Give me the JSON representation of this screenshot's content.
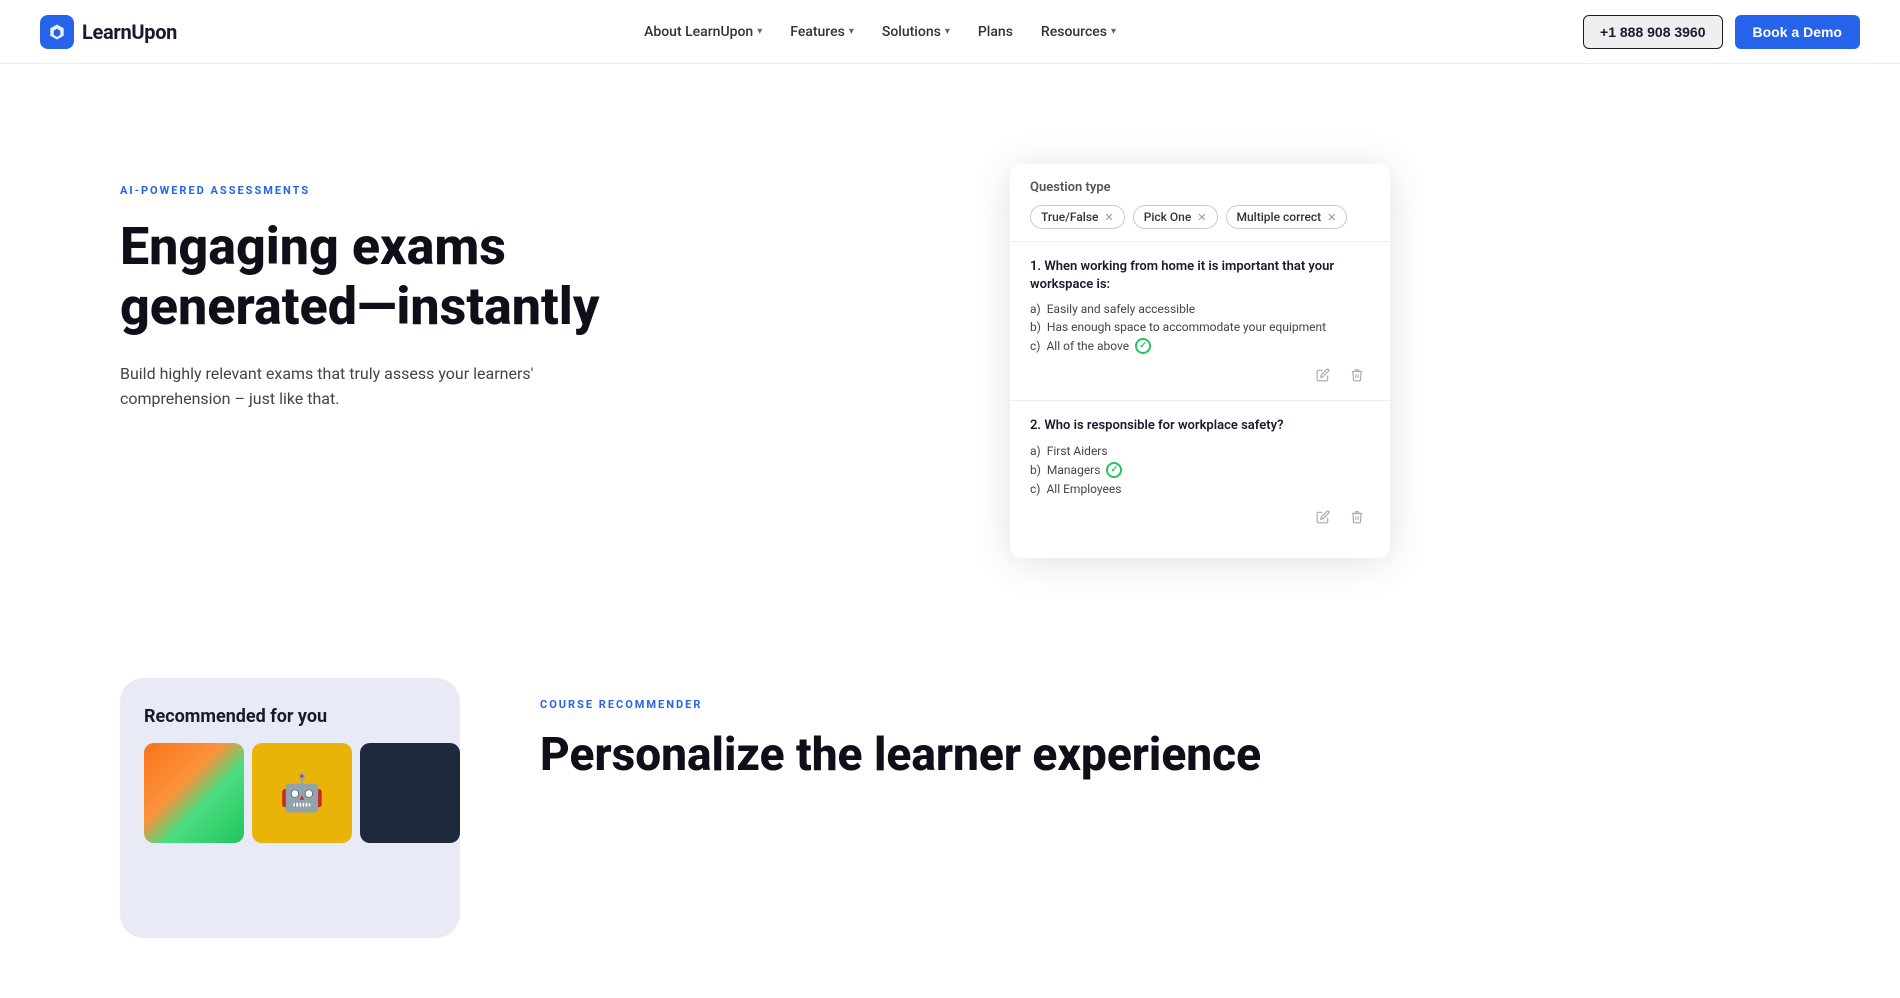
{
  "nav": {
    "logo_text": "LearnUpon",
    "links": [
      {
        "label": "About LearnUpon",
        "has_dropdown": true
      },
      {
        "label": "Features",
        "has_dropdown": true
      },
      {
        "label": "Solutions",
        "has_dropdown": true
      },
      {
        "label": "Plans",
        "has_dropdown": false
      },
      {
        "label": "Resources",
        "has_dropdown": true
      }
    ],
    "phone": "+1 888 908 3960",
    "demo_label": "Book a Demo"
  },
  "hero": {
    "badge": "AI-POWERED ASSESSMENTS",
    "title": "Engaging exams generated—instantly",
    "description": "Build highly relevant exams that truly assess your learners' comprehension – just like that."
  },
  "question_card": {
    "section_label": "Question type",
    "tags": [
      {
        "label": "True/False",
        "id": "tag-true-false"
      },
      {
        "label": "Pick One",
        "id": "tag-pick-one"
      },
      {
        "label": "Multiple correct",
        "id": "tag-multiple-correct"
      }
    ],
    "questions": [
      {
        "number": "1.",
        "text": "When working from home it is important that your workspace is:",
        "options": [
          {
            "letter": "a)",
            "text": "Easily and safely accessible",
            "correct": false
          },
          {
            "letter": "b)",
            "text": "Has enough space to accommodate your equipment",
            "correct": false
          },
          {
            "letter": "c)",
            "text": "All of the above",
            "correct": true
          }
        ]
      },
      {
        "number": "2.",
        "text": "Who is responsible for workplace safety?",
        "options": [
          {
            "letter": "a)",
            "text": "First Aiders",
            "correct": false
          },
          {
            "letter": "b)",
            "text": "Managers",
            "correct": true
          },
          {
            "letter": "c)",
            "text": "All Employees",
            "correct": false
          }
        ]
      }
    ],
    "edit_tooltip": "Edit",
    "delete_tooltip": "Delete"
  },
  "bottom": {
    "badge": "COURSE RECOMMENDER",
    "title": "Personalize the learner experience",
    "card_title": "Recommended for you"
  }
}
